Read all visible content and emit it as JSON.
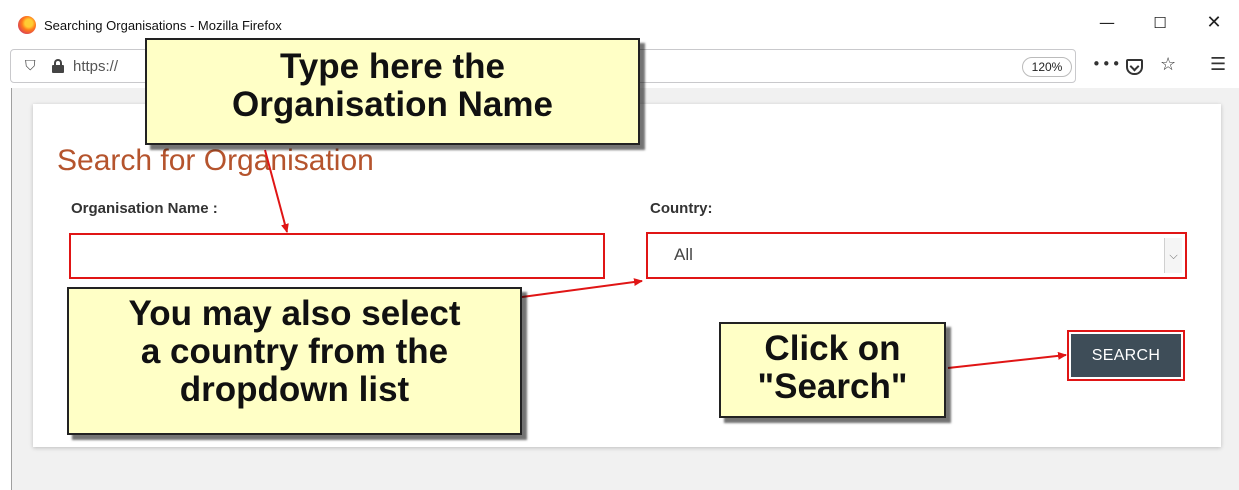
{
  "window": {
    "title": "Searching Organisations - Mozilla Firefox",
    "controls": {
      "minimize": "—",
      "maximize": "☐",
      "close": "✕"
    }
  },
  "toolbar": {
    "url": "https://",
    "zoom": "120%",
    "icons": [
      "shield-icon",
      "lock-icon",
      "more-icon",
      "pocket-icon",
      "star-icon",
      "menu-icon"
    ]
  },
  "form": {
    "title": "Search for Organisation",
    "org_label": "Organisation Name :",
    "org_value": "",
    "country_label": "Country:",
    "country_value": "All",
    "search_label": "SEARCH"
  },
  "annotations": {
    "type_here": [
      "Type here the",
      "Organisation Name"
    ],
    "select_country": [
      "You may also select",
      "a country from the",
      "dropdown list"
    ],
    "click_search": [
      "Click on",
      "\"Search\""
    ]
  },
  "colors": {
    "title": "#b5542d",
    "highlight_border": "#e01515",
    "button": "#3e4d58",
    "callout_fill": "#ffffc6",
    "page_bg": "#f1f1f1"
  }
}
